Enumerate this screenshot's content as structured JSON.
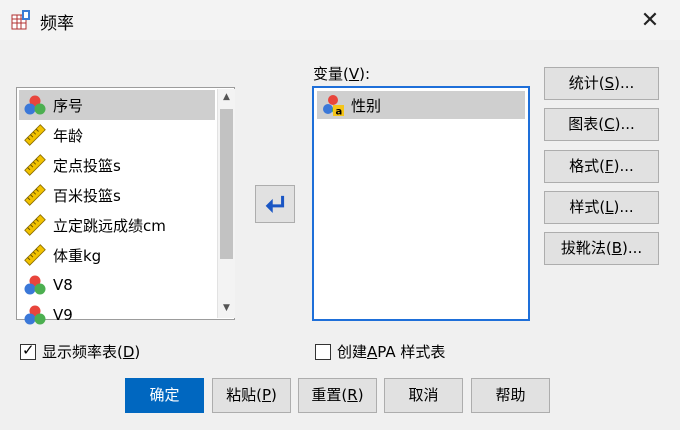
{
  "window": {
    "title": "频率",
    "close": "✕"
  },
  "source_list": {
    "items": [
      {
        "label": "序号",
        "icon": "nominal-icon",
        "selected": true
      },
      {
        "label": "年龄",
        "icon": "scale-icon",
        "selected": false
      },
      {
        "label": "定点投篮s",
        "icon": "scale-icon",
        "selected": false
      },
      {
        "label": "百米投篮s",
        "icon": "scale-icon",
        "selected": false
      },
      {
        "label": "立定跳远成绩cm",
        "icon": "scale-icon",
        "selected": false
      },
      {
        "label": "体重kg",
        "icon": "scale-icon",
        "selected": false
      },
      {
        "label": "V8",
        "icon": "nominal-icon",
        "selected": false
      },
      {
        "label": "V9",
        "icon": "nominal-icon",
        "selected": false
      }
    ]
  },
  "variables": {
    "label_pre": "变量(",
    "label_key": "V",
    "label_post": "):",
    "items": [
      {
        "label": "性别",
        "icon": "nominal-string-icon"
      }
    ]
  },
  "side_buttons": [
    {
      "pre": "统计(",
      "key": "S",
      "post": ")..."
    },
    {
      "pre": "图表(",
      "key": "C",
      "post": ")..."
    },
    {
      "pre": "格式(",
      "key": "F",
      "post": ")..."
    },
    {
      "pre": "样式(",
      "key": "L",
      "post": ")..."
    },
    {
      "pre": "拔靴法(",
      "key": "B",
      "post": ")..."
    }
  ],
  "checkboxes": {
    "show_table": {
      "pre": "显示频率表(",
      "key": "D",
      "post": ")",
      "checked": true
    },
    "apa": {
      "pre": "创建 ",
      "key": "A",
      "post": "PA 样式表",
      "checked": false
    }
  },
  "bottom_buttons": {
    "ok": {
      "label": "确定"
    },
    "paste": {
      "pre": "粘贴(",
      "key": "P",
      "post": ")"
    },
    "reset": {
      "pre": "重置(",
      "key": "R",
      "post": ")"
    },
    "cancel": {
      "label": "取消"
    },
    "help": {
      "label": "帮助"
    }
  },
  "colors": {
    "accent": "#0067c0",
    "focus_border": "#1e6fd9",
    "selected_row": "#cfcfcf"
  }
}
